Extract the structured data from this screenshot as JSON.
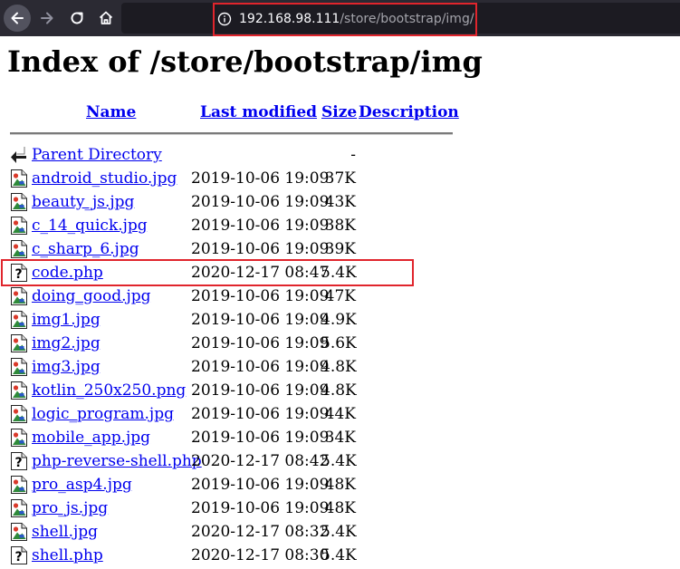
{
  "browser": {
    "url_host": "192.168.98.111",
    "url_path": "/store/bootstrap/img/",
    "icons": {
      "back": "back-arrow-icon",
      "forward": "forward-arrow-icon",
      "reload": "reload-icon",
      "home": "home-icon",
      "site_info": "info-icon"
    }
  },
  "page": {
    "title": "Index of /store/bootstrap/img",
    "columns": {
      "name": "Name",
      "last_modified": "Last modified",
      "size": "Size",
      "description": "Description"
    },
    "parent": {
      "name": "Parent Directory",
      "size": "-"
    },
    "files": [
      {
        "name": "android_studio.jpg",
        "modified": "2019-10-06 19:09",
        "size": "37K",
        "type": "image"
      },
      {
        "name": "beauty_js.jpg",
        "modified": "2019-10-06 19:09",
        "size": "43K",
        "type": "image"
      },
      {
        "name": "c_14_quick.jpg",
        "modified": "2019-10-06 19:09",
        "size": "38K",
        "type": "image"
      },
      {
        "name": "c_sharp_6.jpg",
        "modified": "2019-10-06 19:09",
        "size": "39K",
        "type": "image"
      },
      {
        "name": "code.php",
        "modified": "2020-12-17 08:47",
        "size": "5.4K",
        "type": "unknown"
      },
      {
        "name": "doing_good.jpg",
        "modified": "2019-10-06 19:09",
        "size": "47K",
        "type": "image"
      },
      {
        "name": "img1.jpg",
        "modified": "2019-10-06 19:09",
        "size": "4.9K",
        "type": "image"
      },
      {
        "name": "img2.jpg",
        "modified": "2019-10-06 19:09",
        "size": "5.6K",
        "type": "image"
      },
      {
        "name": "img3.jpg",
        "modified": "2019-10-06 19:09",
        "size": "4.8K",
        "type": "image"
      },
      {
        "name": "kotlin_250x250.png",
        "modified": "2019-10-06 19:09",
        "size": "4.8K",
        "type": "image"
      },
      {
        "name": "logic_program.jpg",
        "modified": "2019-10-06 19:09",
        "size": "44K",
        "type": "image"
      },
      {
        "name": "mobile_app.jpg",
        "modified": "2019-10-06 19:09",
        "size": "34K",
        "type": "image"
      },
      {
        "name": "php-reverse-shell.php",
        "modified": "2020-12-17 08:42",
        "size": "5.4K",
        "type": "unknown"
      },
      {
        "name": "pro_asp4.jpg",
        "modified": "2019-10-06 19:09",
        "size": "48K",
        "type": "image"
      },
      {
        "name": "pro_js.jpg",
        "modified": "2019-10-06 19:09",
        "size": "48K",
        "type": "image"
      },
      {
        "name": "shell.jpg",
        "modified": "2020-12-17 08:32",
        "size": "5.4K",
        "type": "image"
      },
      {
        "name": "shell.php",
        "modified": "2020-12-17 08:30",
        "size": "5.4K",
        "type": "unknown"
      }
    ]
  },
  "annotations": {
    "highlight_color": "#e0252c",
    "highlighted_row": "code.php"
  }
}
